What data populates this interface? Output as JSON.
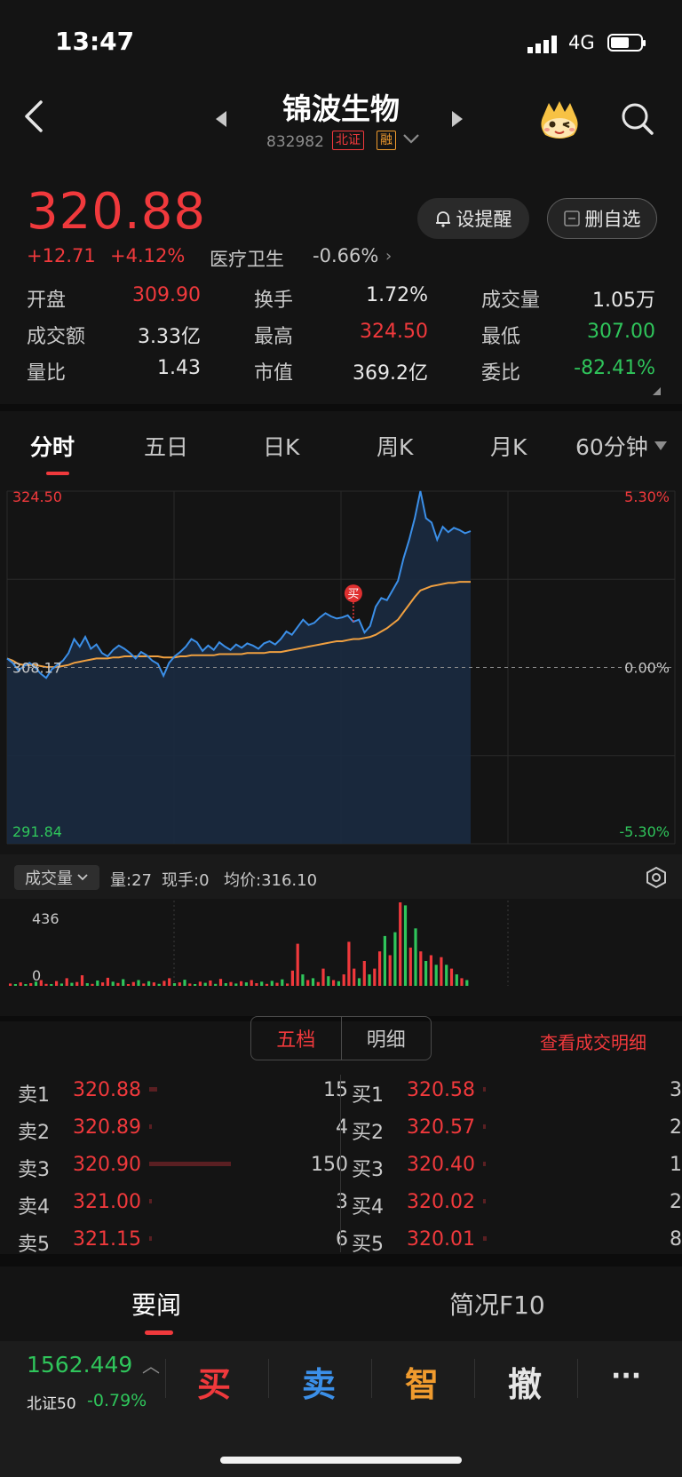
{
  "status_bar": {
    "time": "13:47",
    "network": "4G"
  },
  "header": {
    "name": "锦波生物",
    "code": "832982",
    "tag_exchange": "北证",
    "tag_margin": "融"
  },
  "quote": {
    "price": "320.88",
    "change_abs": "+12.71",
    "change_pct": "+4.12%",
    "sector": "医疗卫生",
    "sector_change": "-0.66%",
    "alert_label": "设提醒",
    "watch_label": "删自选"
  },
  "stats": [
    {
      "label": "开盘",
      "value": "309.90",
      "color": "red"
    },
    {
      "label": "换手",
      "value": "1.72%",
      "color": "white"
    },
    {
      "label": "成交量",
      "value": "1.05万",
      "color": "white"
    },
    {
      "label": "成交额",
      "value": "3.33亿",
      "color": "white"
    },
    {
      "label": "最高",
      "value": "324.50",
      "color": "red"
    },
    {
      "label": "最低",
      "value": "307.00",
      "color": "green"
    },
    {
      "label": "量比",
      "value": "1.43",
      "color": "white"
    },
    {
      "label": "市值",
      "value": "369.2亿",
      "color": "white"
    },
    {
      "label": "委比",
      "value": "-82.41%",
      "color": "green"
    }
  ],
  "chart_tabs": [
    "分时",
    "五日",
    "日K",
    "周K",
    "月K",
    "60分钟"
  ],
  "chart_data": {
    "type": "line",
    "y_left_labels": {
      "top": "324.50",
      "mid": "308.17",
      "bottom": "291.84"
    },
    "y_right_labels": {
      "top": "5.30%",
      "mid": "0.00%",
      "bottom": "-5.30%"
    },
    "ylim": [
      291.84,
      324.5
    ],
    "prev_close": 308.17,
    "trade_marker": "买",
    "colors": {
      "price": "#3b8fe8",
      "avg": "#f0a040",
      "up": "#f0393c",
      "down": "#2fc55b"
    },
    "series": [
      {
        "values": [
          309.0,
          308.6,
          307.9,
          308.3,
          308.6,
          308.2,
          307.6,
          307.2,
          308.0,
          308.4,
          308.8,
          309.5,
          310.8,
          310.1,
          311.0,
          309.9,
          310.3,
          309.5,
          309.2,
          309.8,
          310.2,
          309.9,
          309.5,
          309.0,
          309.6,
          309.3,
          308.8,
          308.5,
          307.4,
          308.6,
          309.2,
          309.6,
          310.1,
          310.8,
          310.5,
          309.7,
          310.2,
          309.8,
          310.5,
          310.1,
          309.8,
          310.3,
          310.0,
          310.4,
          310.2,
          309.9,
          310.4,
          310.6,
          310.3,
          310.8,
          311.5,
          311.2,
          311.9,
          312.6,
          312.1,
          312.3,
          312.8,
          313.2,
          312.9,
          312.7,
          312.8,
          313.0,
          312.4,
          312.6,
          311.4,
          312.0,
          313.8,
          314.6,
          314.4,
          315.3,
          316.2,
          318.3,
          320.0,
          322.0,
          324.5,
          322.0,
          321.6,
          320.0,
          321.2,
          320.7,
          321.1,
          320.9,
          320.6,
          320.8
        ]
      },
      {
        "values": [
          309.0,
          308.8,
          308.5,
          308.4,
          308.4,
          308.4,
          308.3,
          308.2,
          308.2,
          308.2,
          308.3,
          308.4,
          308.6,
          308.7,
          308.8,
          308.9,
          309.0,
          309.0,
          309.0,
          309.1,
          309.1,
          309.2,
          309.2,
          309.2,
          309.2,
          309.2,
          309.2,
          309.2,
          309.1,
          309.1,
          309.1,
          309.2,
          309.2,
          309.3,
          309.3,
          309.3,
          309.3,
          309.3,
          309.4,
          309.4,
          309.4,
          309.4,
          309.4,
          309.5,
          309.5,
          309.5,
          309.5,
          309.6,
          309.6,
          309.6,
          309.7,
          309.8,
          309.9,
          310.0,
          310.1,
          310.2,
          310.3,
          310.4,
          310.5,
          310.6,
          310.6,
          310.7,
          310.8,
          310.8,
          310.9,
          311.0,
          311.2,
          311.5,
          311.8,
          312.2,
          312.6,
          313.3,
          314.0,
          314.7,
          315.3,
          315.5,
          315.7,
          315.8,
          315.9,
          316.0,
          316.0,
          316.1,
          316.1,
          316.1
        ]
      }
    ],
    "volume": {
      "max_label": "436",
      "min_label": "0",
      "bars": [
        12,
        6,
        18,
        9,
        14,
        22,
        30,
        10,
        8,
        25,
        12,
        40,
        16,
        20,
        55,
        14,
        10,
        28,
        18,
        42,
        22,
        15,
        35,
        9,
        20,
        30,
        12,
        24,
        18,
        10,
        26,
        40,
        14,
        18,
        32,
        12,
        8,
        22,
        16,
        28,
        10,
        36,
        14,
        20,
        12,
        24,
        18,
        30,
        14,
        22,
        10,
        26,
        16,
        34,
        12,
        80,
        220,
        60,
        30,
        40,
        20,
        90,
        50,
        30,
        24,
        60,
        230,
        90,
        40,
        130,
        60,
        90,
        180,
        260,
        160,
        280,
        436,
        420,
        200,
        300,
        180,
        130,
        160,
        110,
        150,
        110,
        90,
        60,
        40,
        30
      ],
      "bar_dirs": [
        1,
        0,
        1,
        0,
        1,
        0,
        1,
        1,
        0,
        1,
        0,
        1,
        0,
        1,
        1,
        0,
        1,
        0,
        1,
        1,
        0,
        1,
        0,
        1,
        1,
        0,
        1,
        0,
        1,
        0,
        1,
        1,
        0,
        1,
        0,
        1,
        0,
        1,
        0,
        1,
        0,
        1,
        0,
        1,
        0,
        1,
        0,
        1,
        1,
        0,
        1,
        0,
        1,
        0,
        1,
        1,
        1,
        0,
        1,
        0,
        1,
        1,
        0,
        1,
        0,
        1,
        1,
        1,
        0,
        1,
        0,
        1,
        1,
        0,
        1,
        0,
        1,
        0,
        1,
        0,
        1,
        0,
        1,
        0,
        1,
        0,
        1,
        0,
        1,
        0
      ]
    }
  },
  "volume_toolbar": {
    "dropdown": "成交量",
    "qty": "量:27",
    "hand": "现手:0",
    "avg": "均价:316.10"
  },
  "orderbook": {
    "tab_active": "五档",
    "tab_other": "明细",
    "view_detail": "查看成交明细",
    "asks": [
      {
        "label": "卖1",
        "price": "320.88",
        "vol": "15",
        "ratio": 0.1
      },
      {
        "label": "卖2",
        "price": "320.89",
        "vol": "4",
        "ratio": 0.02
      },
      {
        "label": "卖3",
        "price": "320.90",
        "vol": "150",
        "ratio": 1.0
      },
      {
        "label": "卖4",
        "price": "321.00",
        "vol": "3",
        "ratio": 0.02
      },
      {
        "label": "卖5",
        "price": "321.15",
        "vol": "6",
        "ratio": 0.03
      }
    ],
    "bids": [
      {
        "label": "买1",
        "price": "320.58",
        "vol": "3",
        "ratio": 0.02
      },
      {
        "label": "买2",
        "price": "320.57",
        "vol": "2",
        "ratio": 0.02
      },
      {
        "label": "买3",
        "price": "320.40",
        "vol": "1",
        "ratio": 0.01
      },
      {
        "label": "买4",
        "price": "320.02",
        "vol": "2",
        "ratio": 0.02
      },
      {
        "label": "买5",
        "price": "320.01",
        "vol": "8",
        "ratio": 0.04
      }
    ]
  },
  "news_tabs": [
    "要闻",
    "简况F10"
  ],
  "bottom_bar": {
    "index_value": "1562.449",
    "index_name": "北证50",
    "index_change": "-0.79%",
    "buy": "买",
    "sell": "卖",
    "smart": "智",
    "cancel": "撤",
    "more": "···"
  }
}
